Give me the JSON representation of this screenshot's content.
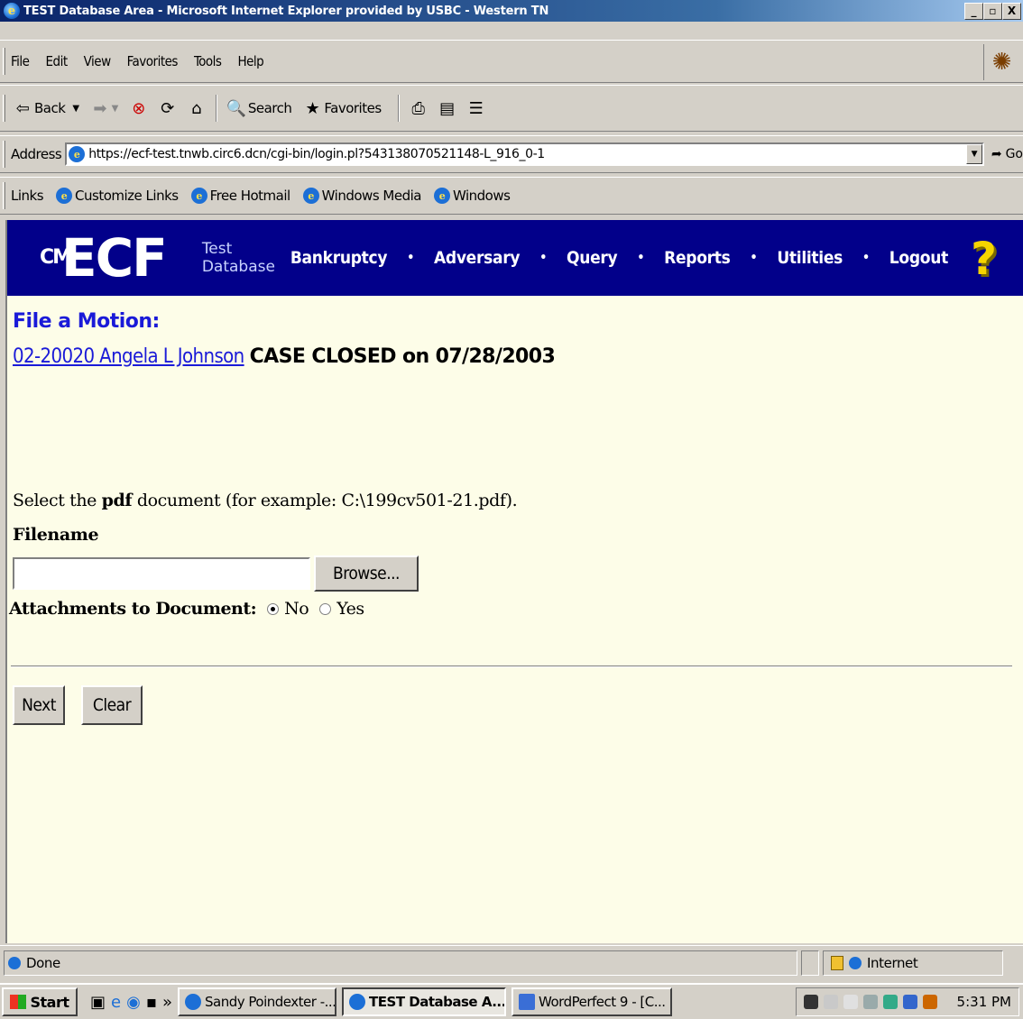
{
  "window": {
    "title": "TEST Database Area - Microsoft Internet Explorer provided by USBC - Western TN",
    "minimize": "_",
    "maximize": "▫",
    "close": "X"
  },
  "menubar": {
    "items": [
      "File",
      "Edit",
      "View",
      "Favorites",
      "Tools",
      "Help"
    ]
  },
  "toolbar": {
    "back": "Back",
    "search": "Search",
    "favorites": "Favorites"
  },
  "address": {
    "label": "Address",
    "url": "https://ecf-test.tnwb.circ6.dcn/cgi-bin/login.pl?543138070521148-L_916_0-1",
    "go": "Go"
  },
  "links": {
    "label": "Links",
    "items": [
      "Customize Links",
      "Free Hotmail",
      "Windows Media",
      "Windows"
    ]
  },
  "ecf": {
    "logo": "ECF",
    "logo_prefix": "CM",
    "test_line1": "Test",
    "test_line2": "Database",
    "nav": [
      "Bankruptcy",
      "Adversary",
      "Query",
      "Reports",
      "Utilities",
      "Logout"
    ],
    "nav_separator": "•",
    "help": "?"
  },
  "page": {
    "title": "File a Motion:",
    "case_link": "02-20020 Angela L Johnson",
    "case_status": "CASE CLOSED on 07/28/2003",
    "select_prefix": "Select the ",
    "select_bold": "pdf",
    "select_suffix": " document (for example: C:\\199cv501-21.pdf).",
    "filename_label": "Filename",
    "filename_value": "",
    "browse_label": "Browse...",
    "attachments_label": "Attachments to Document:",
    "radio_no": "No",
    "radio_yes": "Yes",
    "attachments_selected": "No",
    "next_label": "Next",
    "clear_label": "Clear"
  },
  "status": {
    "text": "Done",
    "zone": "Internet"
  },
  "taskbar": {
    "start": "Start",
    "more": "»",
    "tasks": [
      "Sandy Poindexter -...",
      "TEST Database A...",
      "WordPerfect 9 - [C..."
    ],
    "active_task": "TEST Database A...",
    "clock": "5:31 PM"
  }
}
